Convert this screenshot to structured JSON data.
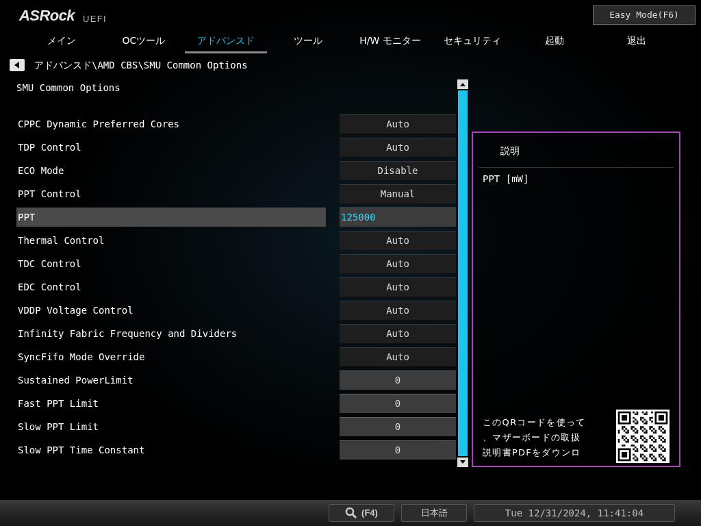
{
  "header": {
    "logo": "ASRock",
    "logo_sub": "UEFI",
    "easy_mode_button": "Easy Mode(F6)"
  },
  "tabs": [
    {
      "label": "メイン",
      "selected": false
    },
    {
      "label": "OCツール",
      "selected": false
    },
    {
      "label": "アドバンスド",
      "selected": true
    },
    {
      "label": "ツール",
      "selected": false
    },
    {
      "label": "H/W モニター",
      "selected": false
    },
    {
      "label": "セキュリティ",
      "selected": false
    },
    {
      "label": "起動",
      "selected": false
    },
    {
      "label": "退出",
      "selected": false
    }
  ],
  "breadcrumb": "アドバンスド\\AMD CBS\\SMU Common Options",
  "section_title": "SMU Common Options",
  "settings": [
    {
      "label": "CPPC Dynamic Preferred Cores",
      "value": "Auto",
      "kind": "select",
      "selected": false
    },
    {
      "label": "TDP Control",
      "value": "Auto",
      "kind": "select",
      "selected": false
    },
    {
      "label": "ECO Mode",
      "value": "Disable",
      "kind": "select",
      "selected": false
    },
    {
      "label": "PPT Control",
      "value": "Manual",
      "kind": "select",
      "selected": false
    },
    {
      "label": "PPT",
      "value": "125000",
      "kind": "number",
      "selected": true
    },
    {
      "label": "Thermal Control",
      "value": "Auto",
      "kind": "select",
      "selected": false
    },
    {
      "label": "TDC Control",
      "value": "Auto",
      "kind": "select",
      "selected": false
    },
    {
      "label": "EDC Control",
      "value": "Auto",
      "kind": "select",
      "selected": false
    },
    {
      "label": "VDDP Voltage Control",
      "value": "Auto",
      "kind": "select",
      "selected": false
    },
    {
      "label": "Infinity Fabric Frequency and Dividers",
      "value": "Auto",
      "kind": "select",
      "selected": false
    },
    {
      "label": "SyncFifo Mode Override",
      "value": "Auto",
      "kind": "select",
      "selected": false
    },
    {
      "label": "Sustained PowerLimit",
      "value": "0",
      "kind": "number",
      "selected": false
    },
    {
      "label": "Fast PPT Limit",
      "value": "0",
      "kind": "number",
      "selected": false
    },
    {
      "label": "Slow PPT Limit",
      "value": "0",
      "kind": "number",
      "selected": false
    },
    {
      "label": "Slow PPT Time Constant",
      "value": "0",
      "kind": "number",
      "selected": false
    }
  ],
  "description": {
    "title": "説明",
    "text": "PPT [mW]",
    "qr_text_lines": [
      "このQRコードを使って",
      "、マザーボードの取扱",
      "説明書PDFをダウンロ"
    ]
  },
  "status_bar": {
    "search_shortcut": "(F4)",
    "language": "日本語",
    "datetime": "Tue 12/31/2024, 11:41:04"
  }
}
